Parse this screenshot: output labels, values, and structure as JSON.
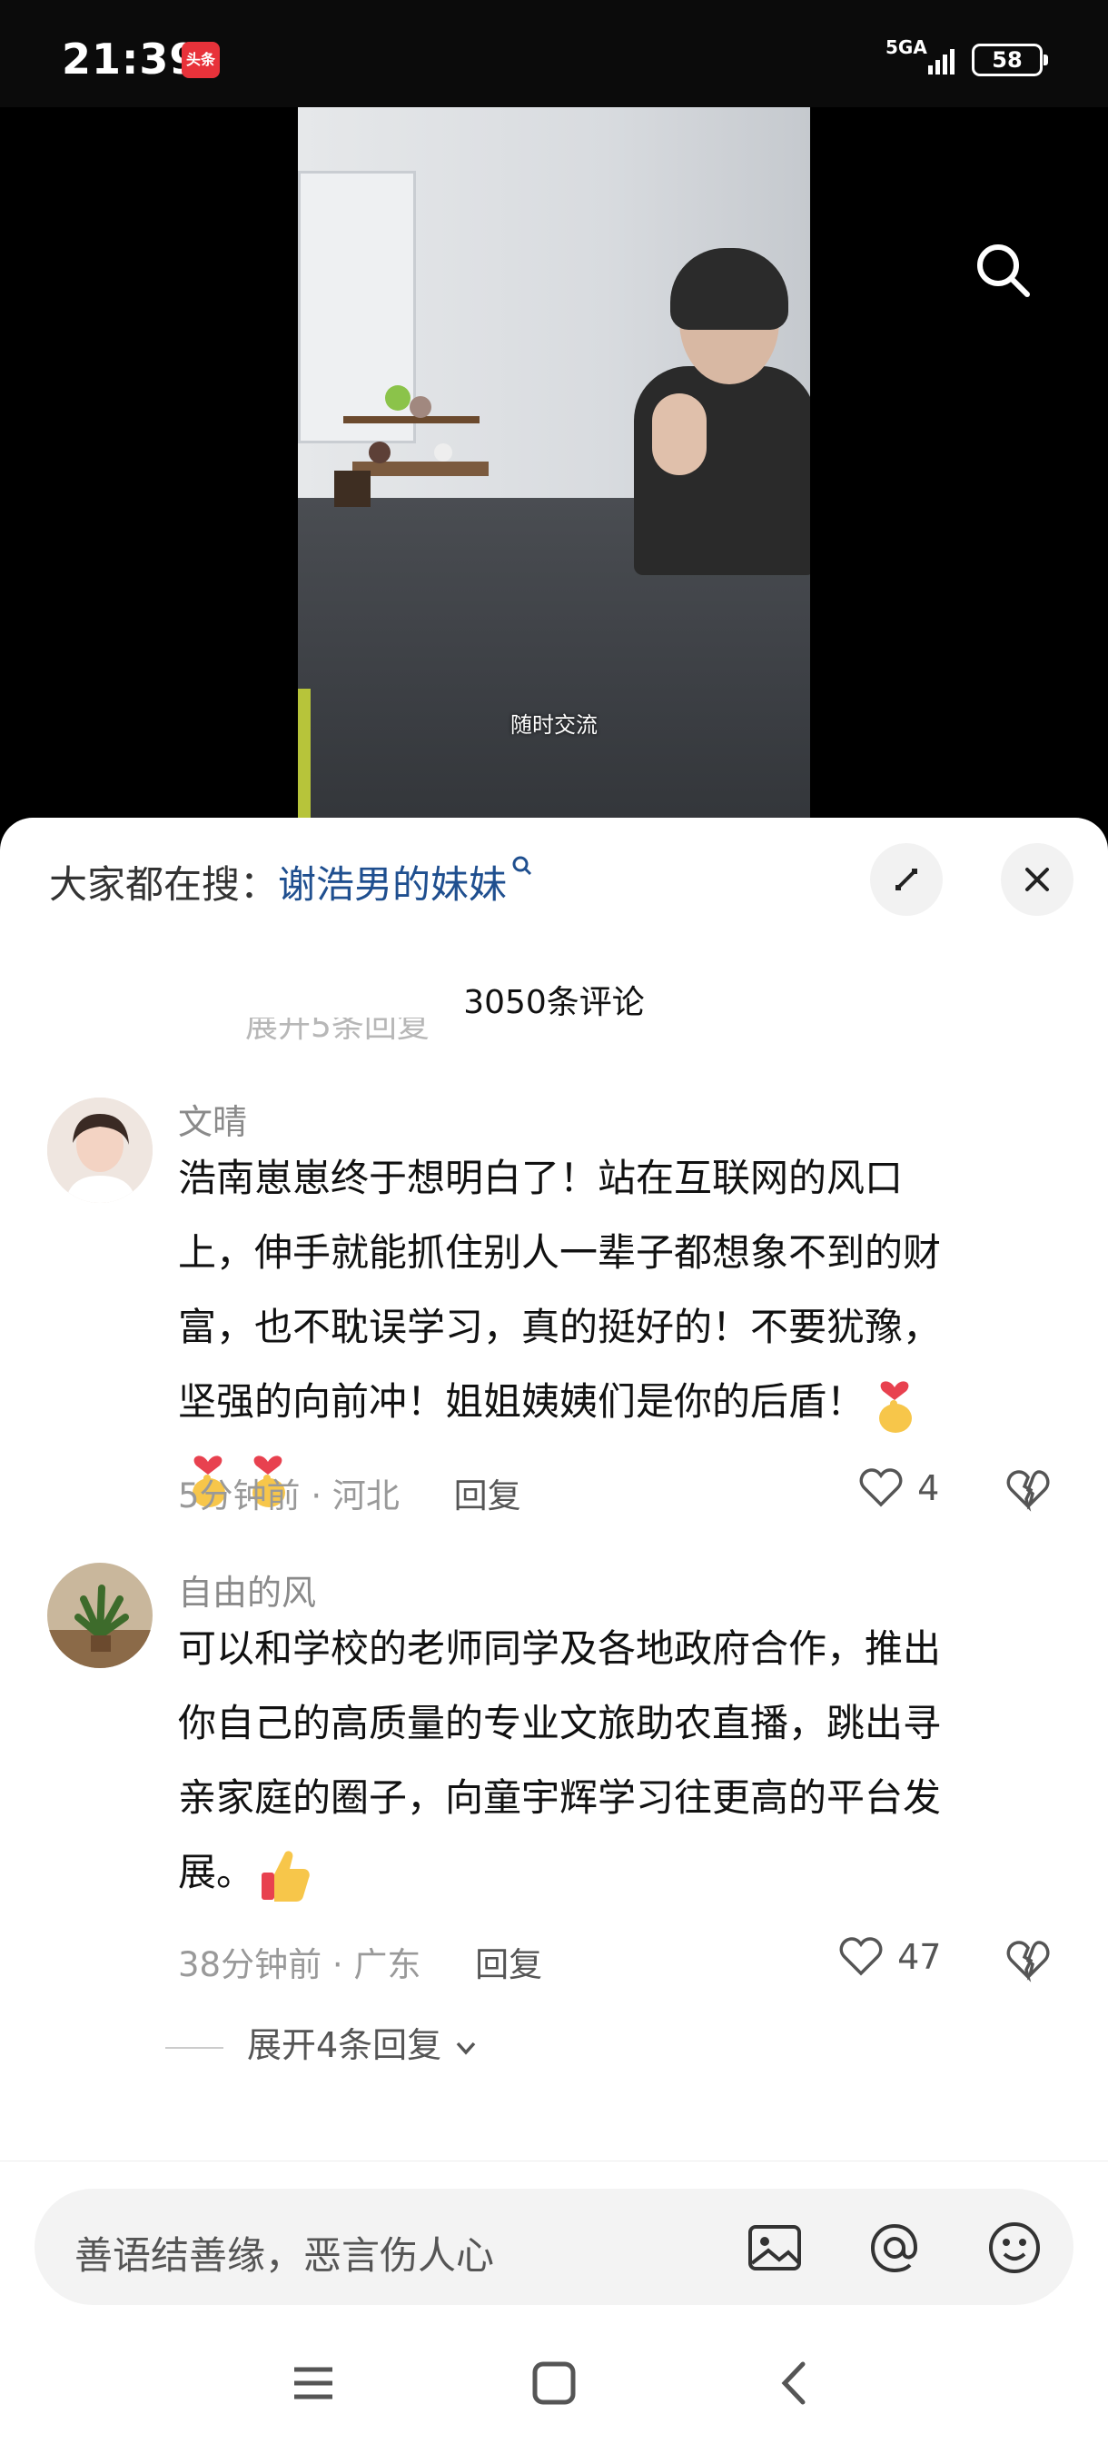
{
  "status_bar": {
    "time": "21:39",
    "app_badge": "头条",
    "network": "5GA",
    "battery": "58"
  },
  "video": {
    "subtitle": "随时交流"
  },
  "sheet": {
    "hot_search_label": "大家都在搜：",
    "hot_search_term": "谢浩男的妹妹",
    "comment_count": "3050条评论",
    "faded_reply_text": "展开5条回复"
  },
  "comments": [
    {
      "username": "文晴",
      "text_line1": "浩南崽崽终于想明白了！站在互联网的风口",
      "text_line2": "上，伸手就能抓住别人一辈子都想象不到的财",
      "text_line3": "富，也不耽误学习，真的挺好的！不要犹豫，",
      "text_line4": "坚强的向前冲！姐姐姨姨们是你的后盾！",
      "time": "5分钟前",
      "location": "河北",
      "reply_label": "回复",
      "likes": "4"
    },
    {
      "username": "自由的风",
      "text_line1": "可以和学校的老师同学及各地政府合作，推出",
      "text_line2": "你自己的高质量的专业文旅助农直播，跳出寻",
      "text_line3": "亲家庭的圈子，向童宇辉学习往更高的平台发",
      "text_line4": "展。",
      "time": "38分钟前",
      "location": "广东",
      "reply_label": "回复",
      "likes": "47",
      "expand_replies": "展开4条回复"
    }
  ],
  "input_bar": {
    "placeholder": "善语结善缘，恶言伤人心"
  },
  "icons": {
    "search": "search-icon",
    "expand": "expand-icon",
    "close": "close-icon",
    "heart": "heart-icon",
    "broken_heart": "broken-heart-icon",
    "image": "image-icon",
    "mention": "at-icon",
    "emoji": "emoji-icon",
    "finger_heart": "finger-heart-emoji",
    "thumbs_up": "thumbs-up-emoji"
  },
  "colors": {
    "hot_search_term": "#1f4f8f",
    "app_badge": "#e8323a"
  }
}
